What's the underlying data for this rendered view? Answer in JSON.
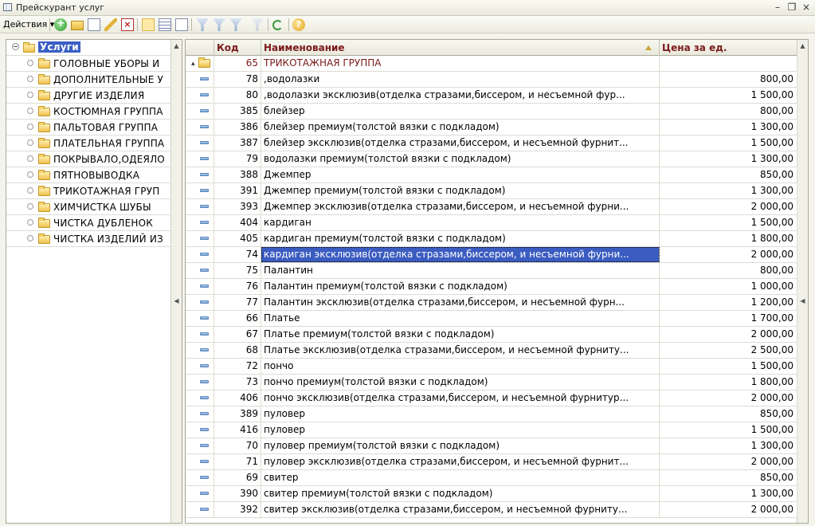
{
  "window": {
    "title": "Прейскурант услуг"
  },
  "toolbar": {
    "actions_label": "Действия"
  },
  "tree": {
    "root_label": "Услуги",
    "items": [
      "ГОЛОВНЫЕ УБОРЫ И",
      "ДОПОЛНИТЕЛЬНЫЕ У",
      "ДРУГИЕ ИЗДЕЛИЯ",
      "КОСТЮМНАЯ ГРУППА",
      "ПАЛЬТОВАЯ ГРУППА",
      "ПЛАТЕЛЬНАЯ ГРУППА",
      "ПОКРЫВАЛО,ОДЕЯЛО",
      "ПЯТНОВЫВОДКА",
      "ТРИКОТАЖНАЯ ГРУП",
      "ХИМЧИСТКА ШУБЫ",
      "ЧИСТКА ДУБЛЕНОК",
      "ЧИСТКА ИЗДЕЛИЙ ИЗ"
    ]
  },
  "grid": {
    "columns": {
      "code": "Код",
      "name": "Наименование",
      "price": "Цена за ед."
    },
    "group": {
      "code": "65",
      "name": "ТРИКОТАЖНАЯ ГРУППА"
    },
    "selected_index": 11,
    "rows": [
      {
        "code": "78",
        "name": ",водолазки",
        "price": "800,00"
      },
      {
        "code": "80",
        "name": ",водолазки эксклюзив(отделка стразами,биссером, и несъемной фур...",
        "price": "1 500,00"
      },
      {
        "code": "385",
        "name": "блейзер",
        "price": "800,00"
      },
      {
        "code": "386",
        "name": "блейзер премиум(толстой вязки с подкладом)",
        "price": "1 300,00"
      },
      {
        "code": "387",
        "name": "блейзер эксклюзив(отделка стразами,биссером, и несъемной фурнит...",
        "price": "1 500,00"
      },
      {
        "code": "79",
        "name": "водолазки премиум(толстой вязки с подкладом)",
        "price": "1 300,00"
      },
      {
        "code": "388",
        "name": "Джемпер",
        "price": "850,00"
      },
      {
        "code": "391",
        "name": "Джемпер премиум(толстой вязки с подкладом)",
        "price": "1 300,00"
      },
      {
        "code": "393",
        "name": "Джемпер эксклюзив(отделка стразами,биссером, и несъемной фурни...",
        "price": "2 000,00"
      },
      {
        "code": "404",
        "name": "кардиган",
        "price": "1 500,00"
      },
      {
        "code": "405",
        "name": "кардиган премиум(толстой вязки с подкладом)",
        "price": "1 800,00"
      },
      {
        "code": "74",
        "name": "кардиган эксклюзив(отделка стразами,биссером, и несъемной фурни...",
        "price": "2 000,00"
      },
      {
        "code": "75",
        "name": "Палантин",
        "price": "800,00"
      },
      {
        "code": "76",
        "name": "Палантин премиум(толстой вязки с подкладом)",
        "price": "1 000,00"
      },
      {
        "code": "77",
        "name": "Палантин эксклюзив(отделка стразами,биссером, и несъемной фурн...",
        "price": "1 200,00"
      },
      {
        "code": "66",
        "name": "Платье",
        "price": "1 700,00"
      },
      {
        "code": "67",
        "name": "Платье премиум(толстой вязки с подкладом)",
        "price": "2 000,00"
      },
      {
        "code": "68",
        "name": "Платье эксклюзив(отделка стразами,биссером, и несъемной фурниту...",
        "price": "2 500,00"
      },
      {
        "code": "72",
        "name": "пончо",
        "price": "1 500,00"
      },
      {
        "code": "73",
        "name": "пончо премиум(толстой вязки с подкладом)",
        "price": "1 800,00"
      },
      {
        "code": "406",
        "name": "пончо эксклюзив(отделка стразами,биссером, и несъемной фурнитур...",
        "price": "2 000,00"
      },
      {
        "code": "389",
        "name": "пуловер",
        "price": "850,00"
      },
      {
        "code": "416",
        "name": "пуловер",
        "price": "1 500,00"
      },
      {
        "code": "70",
        "name": "пуловер премиум(толстой вязки с подкладом)",
        "price": "1 300,00"
      },
      {
        "code": "71",
        "name": "пуловер эксклюзив(отделка стразами,биссером, и несъемной фурнит...",
        "price": "2 000,00"
      },
      {
        "code": "69",
        "name": "свитер",
        "price": "850,00"
      },
      {
        "code": "390",
        "name": "свитер премиум(толстой вязки с подкладом)",
        "price": "1 300,00"
      },
      {
        "code": "392",
        "name": "свитер эксклюзив(отделка стразами,биссером, и несъемной фурниту...",
        "price": "2 000,00"
      }
    ]
  },
  "colors": {
    "header_text": "#7a1a1a",
    "selection": "#3b5cc0"
  }
}
